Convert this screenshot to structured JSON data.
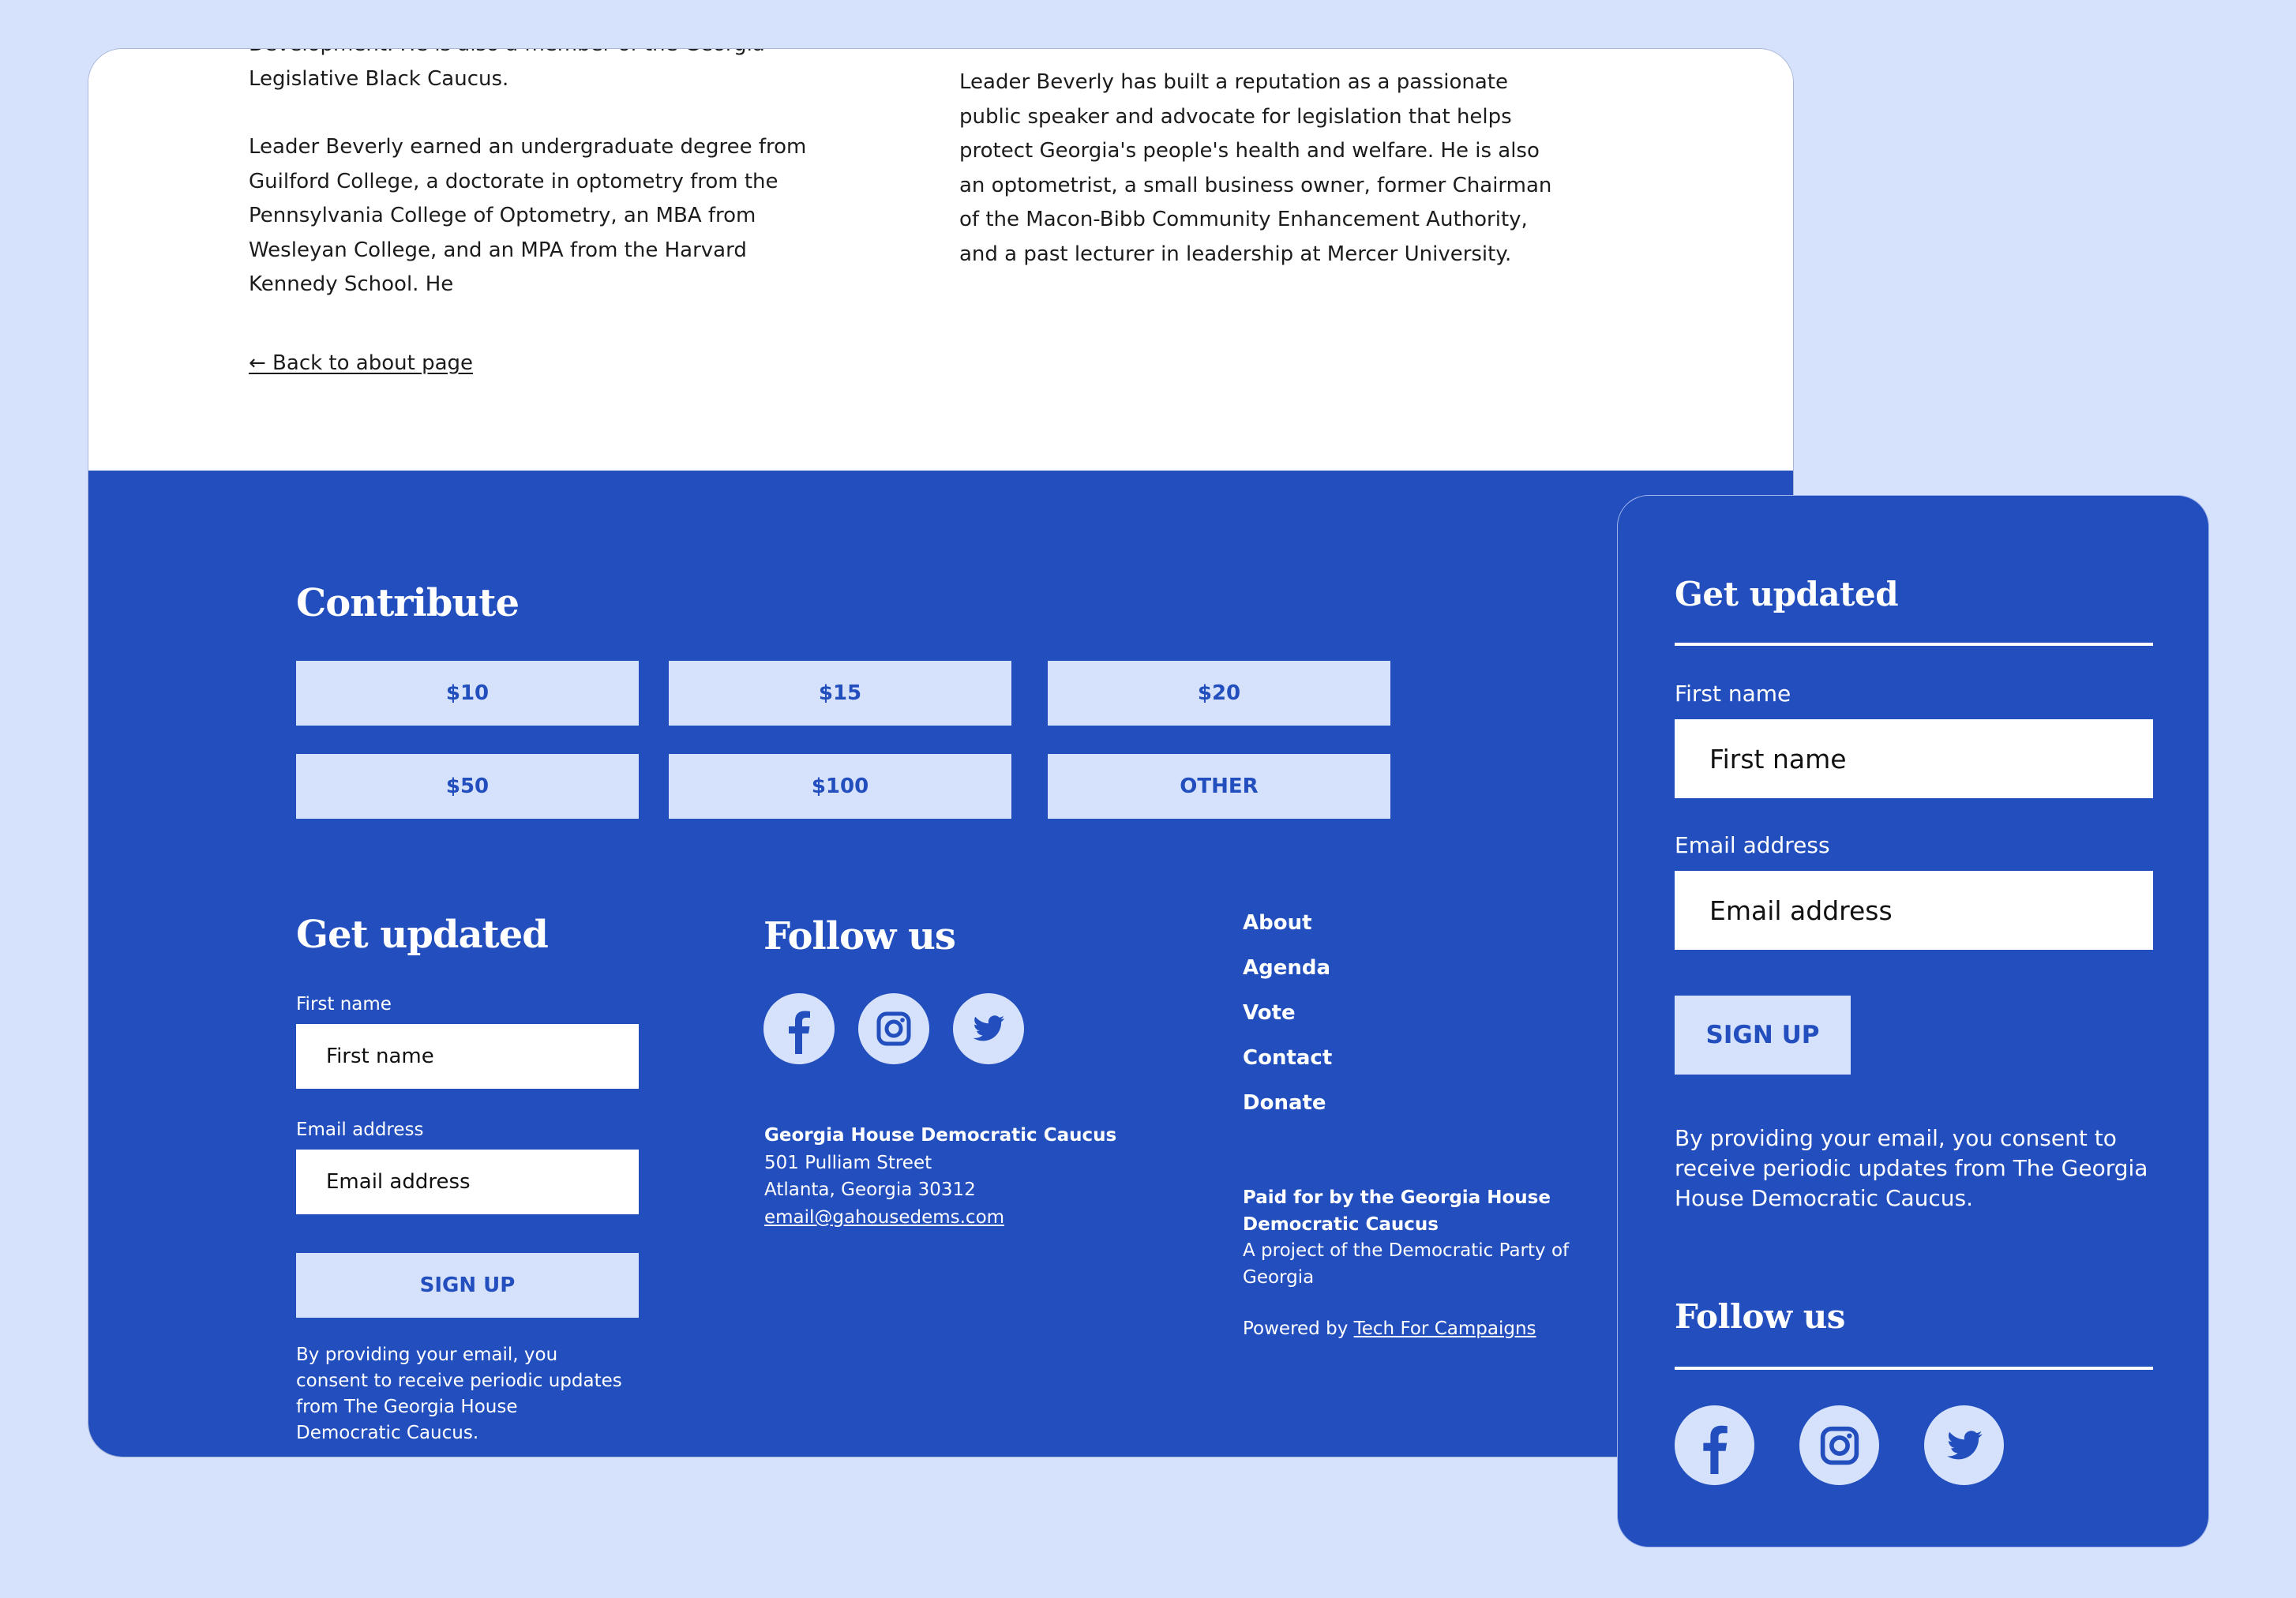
{
  "bio": {
    "col1": {
      "cut_line": "Development. He is also a member of the Georgia",
      "line2": "Legislative Black Caucus.",
      "para2": "Leader Beverly earned an undergraduate degree from Guilford College, a doctorate in optometry from the Pennsylvania College of Optometry, an MBA from Wesleyan College, and an MPA from the Harvard Kennedy School. He"
    },
    "col2": {
      "para": "Leader Beverly has built a reputation as a passionate public speaker and advocate for legislation that helps protect Georgia's people's health and welfare. He is also an optometrist, a small business owner, former Chairman of the Macon-Bibb Community Enhancement Authority, and a past lecturer in leadership at Mercer University."
    },
    "back_link": "← Back to about page"
  },
  "footer": {
    "contribute": {
      "title": "Contribute",
      "amounts": [
        "$10",
        "$15",
        "$20",
        "$50",
        "$100",
        "OTHER"
      ]
    },
    "get_updated": {
      "title": "Get updated",
      "first_name_label": "First name",
      "first_name_placeholder": "First name",
      "email_label": "Email address",
      "email_placeholder": "Email address",
      "signup_label": "SIGN UP",
      "consent": "By providing your email, you consent to receive periodic updates from The Georgia House Democratic Caucus."
    },
    "follow": {
      "title": "Follow us",
      "icons": [
        "facebook-icon",
        "instagram-icon",
        "twitter-icon"
      ]
    },
    "address": {
      "org": "Georgia House Democratic Caucus",
      "street": "501 Pulliam Street",
      "city": "Atlanta, Georgia 30312",
      "email": "email@gahousedems.com"
    },
    "nav": [
      "About",
      "Agenda",
      "Vote",
      "Contact",
      "Donate"
    ],
    "paid_for": "Paid for by the Georgia House Democratic Caucus",
    "project_of": "A project of the Democratic Party of Georgia",
    "powered_prefix": "Powered by ",
    "powered_link": "Tech For Campaigns"
  },
  "side_card": {
    "title": "Get updated",
    "first_name_label": "First name",
    "first_name_placeholder": "First name",
    "email_label": "Email address",
    "email_placeholder": "Email address",
    "signup_label": "SIGN UP",
    "consent": "By providing your email, you consent to receive periodic updates from The Georgia House Democratic Caucus.",
    "follow_title": "Follow us"
  },
  "colors": {
    "background": "#d6e2fc",
    "brand_blue": "#224ebe",
    "button_bg": "#d6e2fc",
    "text_dark": "#1c1c1c"
  }
}
